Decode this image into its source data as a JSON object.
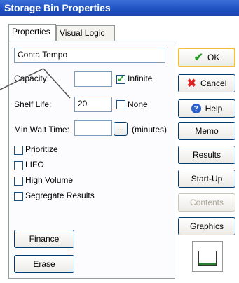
{
  "window": {
    "title": "Storage Bin Properties"
  },
  "tabs": [
    {
      "label": "Properties"
    },
    {
      "label": "Visual Logic"
    }
  ],
  "form": {
    "name_value": "Conta Tempo",
    "capacity_label": "Capacity:",
    "capacity_value": "",
    "infinite_label": "Infinite",
    "infinite_checked": true,
    "shelf_life_label": "Shelf Life:",
    "shelf_life_value": "20",
    "none_label": "None",
    "none_checked": false,
    "min_wait_label": "Min Wait Time:",
    "min_wait_value": "",
    "ellipsis_label": "...",
    "minutes_label": "(minutes)",
    "options": [
      {
        "label": "Prioritize",
        "checked": false
      },
      {
        "label": "LIFO",
        "checked": false
      },
      {
        "label": "High Volume",
        "checked": false
      },
      {
        "label": "Segregate Results",
        "checked": false
      }
    ]
  },
  "left_buttons": {
    "finance": "Finance",
    "erase": "Erase"
  },
  "right_buttons": {
    "ok": "OK",
    "cancel": "Cancel",
    "help": "Help",
    "memo": "Memo",
    "results": "Results",
    "startup": "Start-Up",
    "contents": "Contents",
    "graphics": "Graphics"
  },
  "icons": {
    "ok": "checkmark-icon",
    "cancel": "x-icon",
    "help": "help-icon",
    "bin_graphic": "bin-graphic-icon"
  },
  "colors": {
    "title_bar": "#2456c8",
    "bin_fill": "#2e7d32"
  }
}
